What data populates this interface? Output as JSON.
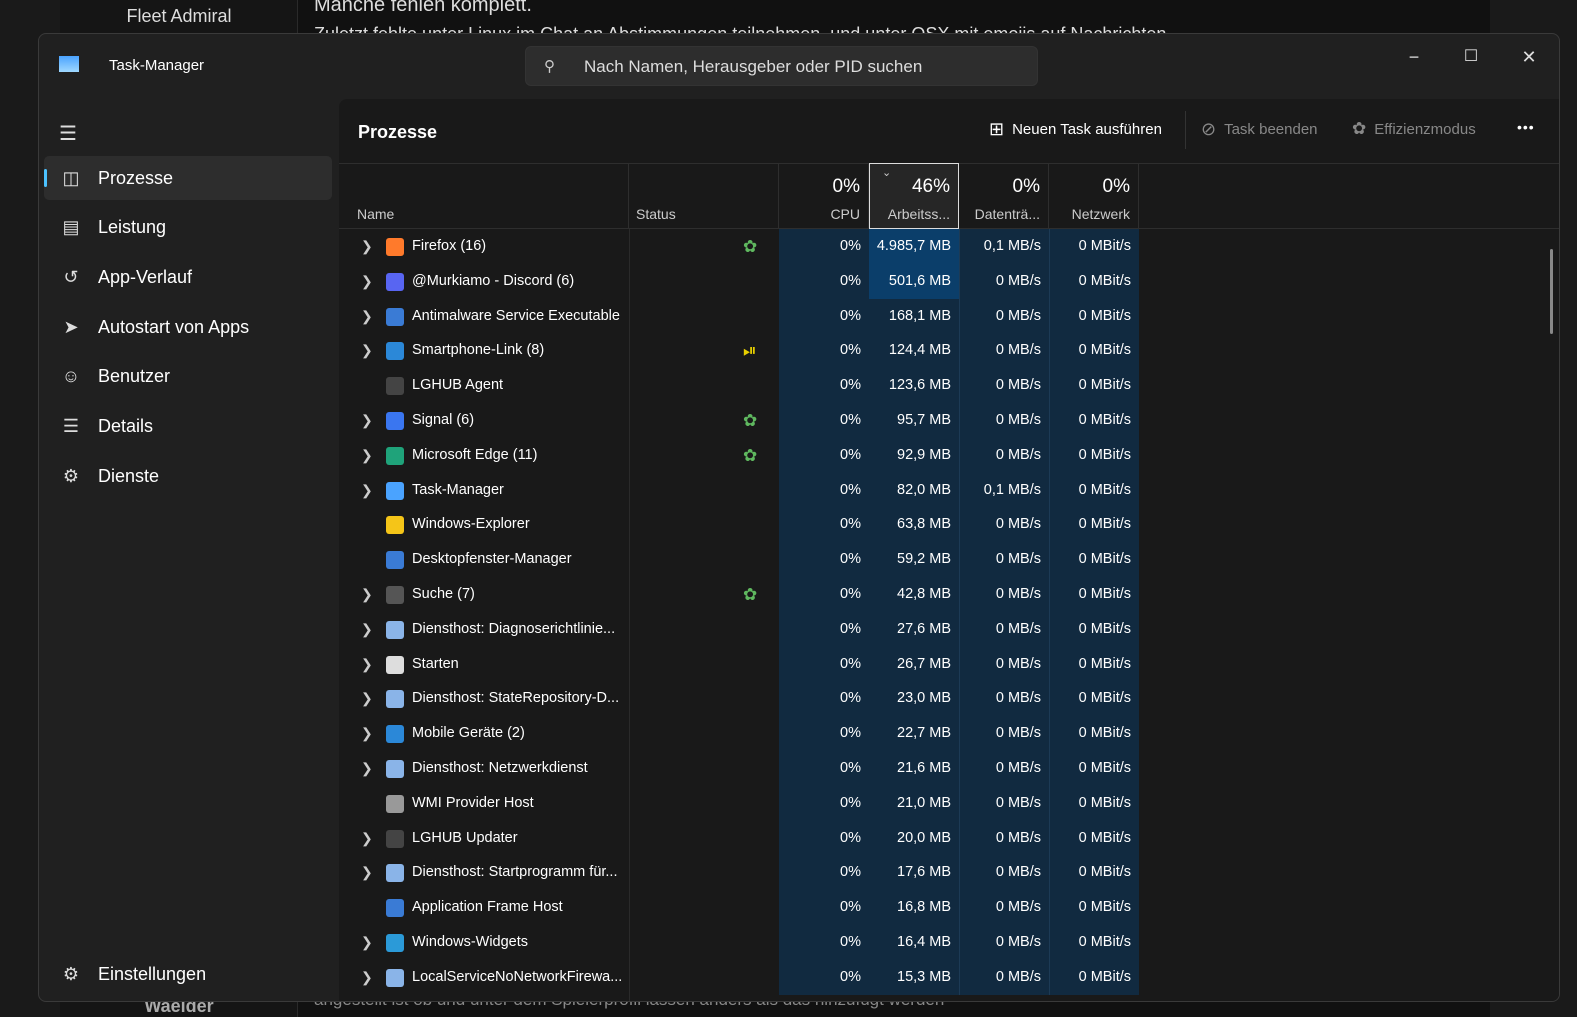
{
  "background": {
    "sidebar_name": "Fleet Admiral",
    "heading": "Manche fehlen komplett.",
    "line": "Zuletzt fehlte unter Linux im Chat an Abstimmungen teilnehmen, und unter OSX mit emojis auf Nachrichten",
    "bottom_name": "Waelder",
    "bottom_line": "angestellt ist ob und unter dem Spielerprofil lassen anders als das hinzufügt werden"
  },
  "window": {
    "title": "Task-Manager",
    "search_placeholder": "Nach Namen, Herausgeber oder PID suchen",
    "icons": {
      "minimize": "−",
      "maximize": "☐",
      "close": "✕"
    }
  },
  "sidebar": {
    "items": [
      {
        "label": "Prozesse",
        "icon": "processes-icon",
        "active": true
      },
      {
        "label": "Leistung",
        "icon": "performance-icon"
      },
      {
        "label": "App-Verlauf",
        "icon": "history-icon"
      },
      {
        "label": "Autostart von Apps",
        "icon": "startup-icon"
      },
      {
        "label": "Benutzer",
        "icon": "users-icon"
      },
      {
        "label": "Details",
        "icon": "details-icon"
      },
      {
        "label": "Dienste",
        "icon": "services-icon"
      }
    ],
    "settings": "Einstellungen"
  },
  "toolbar": {
    "title": "Prozesse",
    "new_task": "Neuen Task ausführen",
    "end_task": "Task beenden",
    "efficiency": "Effizienzmodus",
    "more": "•••"
  },
  "columns": {
    "name": "Name",
    "status": "Status",
    "cpu": {
      "pct": "0%",
      "label": "CPU"
    },
    "mem": {
      "pct": "46%",
      "label": "Arbeitss..."
    },
    "disk": {
      "pct": "0%",
      "label": "Datenträ..."
    },
    "net": {
      "pct": "0%",
      "label": "Netzwerk"
    }
  },
  "colors": {
    "accent": "#4cc2ff",
    "heat_low": "#112a40",
    "heat_high": "#0b3e6a",
    "eco": "#5fb85f",
    "paused": "#e8d000"
  },
  "processes": [
    {
      "name": "Firefox (16)",
      "expand": true,
      "status": "eco",
      "cpu": "0%",
      "mem": "4.985,7 MB",
      "disk": "0,1 MB/s",
      "net": "0 MBit/s",
      "color": "#ff7a2b",
      "hi": true
    },
    {
      "name": "@Murkiamo - Discord (6)",
      "expand": true,
      "status": "",
      "cpu": "0%",
      "mem": "501,6 MB",
      "disk": "0 MB/s",
      "net": "0 MBit/s",
      "color": "#5865f2",
      "hi": true
    },
    {
      "name": "Antimalware Service Executable",
      "expand": true,
      "status": "",
      "cpu": "0%",
      "mem": "168,1 MB",
      "disk": "0 MB/s",
      "net": "0 MBit/s",
      "color": "#3a7bd5"
    },
    {
      "name": "Smartphone-Link (8)",
      "expand": true,
      "status": "paused",
      "cpu": "0%",
      "mem": "124,4 MB",
      "disk": "0 MB/s",
      "net": "0 MBit/s",
      "color": "#2b88d8"
    },
    {
      "name": "LGHUB Agent",
      "expand": false,
      "status": "",
      "cpu": "0%",
      "mem": "123,6 MB",
      "disk": "0 MB/s",
      "net": "0 MBit/s",
      "color": "#444"
    },
    {
      "name": "Signal (6)",
      "expand": true,
      "status": "eco",
      "cpu": "0%",
      "mem": "95,7 MB",
      "disk": "0 MB/s",
      "net": "0 MBit/s",
      "color": "#3a76f0"
    },
    {
      "name": "Microsoft Edge (11)",
      "expand": true,
      "status": "eco",
      "cpu": "0%",
      "mem": "92,9 MB",
      "disk": "0 MB/s",
      "net": "0 MBit/s",
      "color": "#1fa37a"
    },
    {
      "name": "Task-Manager",
      "expand": true,
      "status": "",
      "cpu": "0%",
      "mem": "82,0 MB",
      "disk": "0,1 MB/s",
      "net": "0 MBit/s",
      "color": "#4aa3ff"
    },
    {
      "name": "Windows-Explorer",
      "expand": false,
      "status": "",
      "cpu": "0%",
      "mem": "63,8 MB",
      "disk": "0 MB/s",
      "net": "0 MBit/s",
      "color": "#f5c518"
    },
    {
      "name": "Desktopfenster-Manager",
      "expand": false,
      "status": "",
      "cpu": "0%",
      "mem": "59,2 MB",
      "disk": "0 MB/s",
      "net": "0 MBit/s",
      "color": "#3a7bd5"
    },
    {
      "name": "Suche (7)",
      "expand": true,
      "status": "eco",
      "cpu": "0%",
      "mem": "42,8 MB",
      "disk": "0 MB/s",
      "net": "0 MBit/s",
      "color": "#555"
    },
    {
      "name": "Diensthost: Diagnoserichtlinie...",
      "expand": true,
      "status": "",
      "cpu": "0%",
      "mem": "27,6 MB",
      "disk": "0 MB/s",
      "net": "0 MBit/s",
      "color": "#8ab4e8"
    },
    {
      "name": "Starten",
      "expand": true,
      "status": "",
      "cpu": "0%",
      "mem": "26,7 MB",
      "disk": "0 MB/s",
      "net": "0 MBit/s",
      "color": "#ddd"
    },
    {
      "name": "Diensthost: StateRepository-D...",
      "expand": true,
      "status": "",
      "cpu": "0%",
      "mem": "23,0 MB",
      "disk": "0 MB/s",
      "net": "0 MBit/s",
      "color": "#8ab4e8"
    },
    {
      "name": "Mobile Geräte (2)",
      "expand": true,
      "status": "",
      "cpu": "0%",
      "mem": "22,7 MB",
      "disk": "0 MB/s",
      "net": "0 MBit/s",
      "color": "#2b88d8"
    },
    {
      "name": "Diensthost: Netzwerkdienst",
      "expand": true,
      "status": "",
      "cpu": "0%",
      "mem": "21,6 MB",
      "disk": "0 MB/s",
      "net": "0 MBit/s",
      "color": "#8ab4e8"
    },
    {
      "name": "WMI Provider Host",
      "expand": false,
      "status": "",
      "cpu": "0%",
      "mem": "21,0 MB",
      "disk": "0 MB/s",
      "net": "0 MBit/s",
      "color": "#999"
    },
    {
      "name": "LGHUB Updater",
      "expand": true,
      "status": "",
      "cpu": "0%",
      "mem": "20,0 MB",
      "disk": "0 MB/s",
      "net": "0 MBit/s",
      "color": "#444"
    },
    {
      "name": "Diensthost: Startprogramm für...",
      "expand": true,
      "status": "",
      "cpu": "0%",
      "mem": "17,6 MB",
      "disk": "0 MB/s",
      "net": "0 MBit/s",
      "color": "#8ab4e8"
    },
    {
      "name": "Application Frame Host",
      "expand": false,
      "status": "",
      "cpu": "0%",
      "mem": "16,8 MB",
      "disk": "0 MB/s",
      "net": "0 MBit/s",
      "color": "#3a7bd5"
    },
    {
      "name": "Windows-Widgets",
      "expand": true,
      "status": "",
      "cpu": "0%",
      "mem": "16,4 MB",
      "disk": "0 MB/s",
      "net": "0 MBit/s",
      "color": "#2b9ad8"
    },
    {
      "name": "LocalServiceNoNetworkFirewa...",
      "expand": true,
      "status": "",
      "cpu": "0%",
      "mem": "15,3 MB",
      "disk": "0 MB/s",
      "net": "0 MBit/s",
      "color": "#8ab4e8"
    }
  ]
}
